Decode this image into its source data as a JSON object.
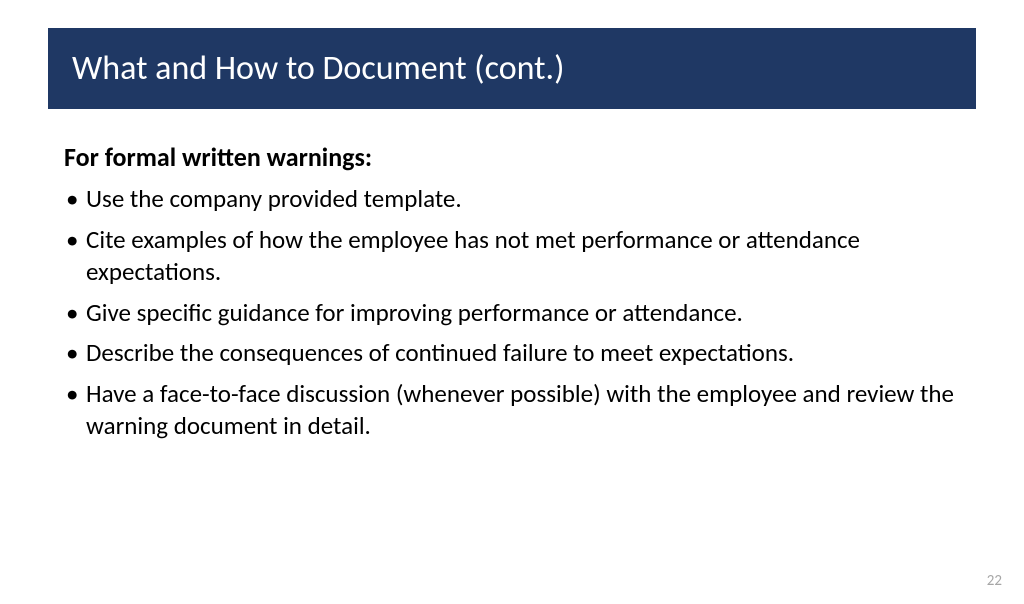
{
  "header": {
    "title": "What and How to Document (cont.)"
  },
  "content": {
    "subheading": "For formal written warnings:",
    "bullets": [
      "Use the company provided template.",
      "Cite examples of how the employee has not met performance or attendance expectations.",
      "Give specific guidance for improving performance or attendance.",
      "Describe the consequences of continued failure to meet expectations.",
      "Have a face-to-face discussion (whenever possible) with the employee and review the warning document in detail."
    ]
  },
  "page_number": "22"
}
